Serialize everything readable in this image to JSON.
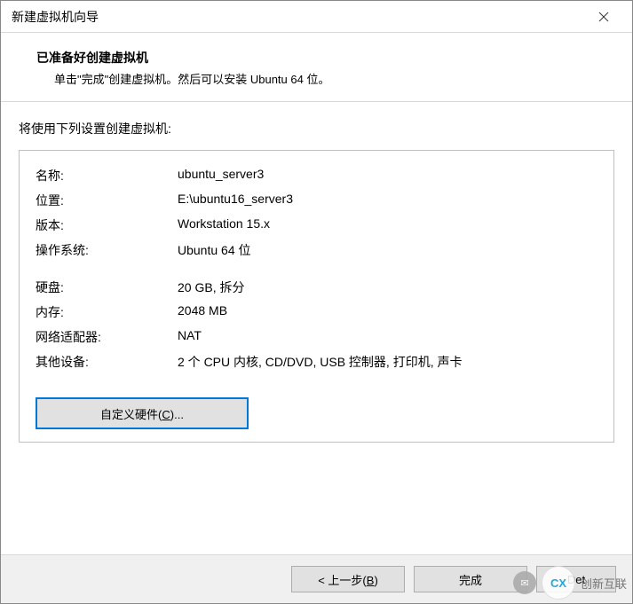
{
  "window": {
    "title": "新建虚拟机向导"
  },
  "header": {
    "title": "已准备好创建虚拟机",
    "subtitle": "单击\"完成\"创建虚拟机。然后可以安装 Ubuntu 64 位。"
  },
  "intro": "将使用下列设置创建虚拟机:",
  "summary": {
    "rows1": [
      {
        "label": "名称:",
        "value": "ubuntu_server3"
      },
      {
        "label": "位置:",
        "value": "E:\\ubuntu16_server3"
      },
      {
        "label": "版本:",
        "value": "Workstation 15.x"
      },
      {
        "label": "操作系统:",
        "value": "Ubuntu 64 位"
      }
    ],
    "rows2": [
      {
        "label": "硬盘:",
        "value": "20 GB, 拆分"
      },
      {
        "label": "内存:",
        "value": "2048 MB"
      },
      {
        "label": "网络适配器:",
        "value": "NAT"
      },
      {
        "label": "其他设备:",
        "value": "2 个 CPU 内核, CD/DVD, USB 控制器, 打印机, 声卡"
      }
    ]
  },
  "buttons": {
    "customize_pre": "自定义硬件(",
    "customize_key": "C",
    "customize_post": ")...",
    "back_pre": "< 上一步(",
    "back_key": "B",
    "back_post": ")",
    "finish": "完成",
    "cancel_partial": "Det"
  },
  "watermark": {
    "text": "创新互联",
    "logo_symbol": "CX"
  }
}
